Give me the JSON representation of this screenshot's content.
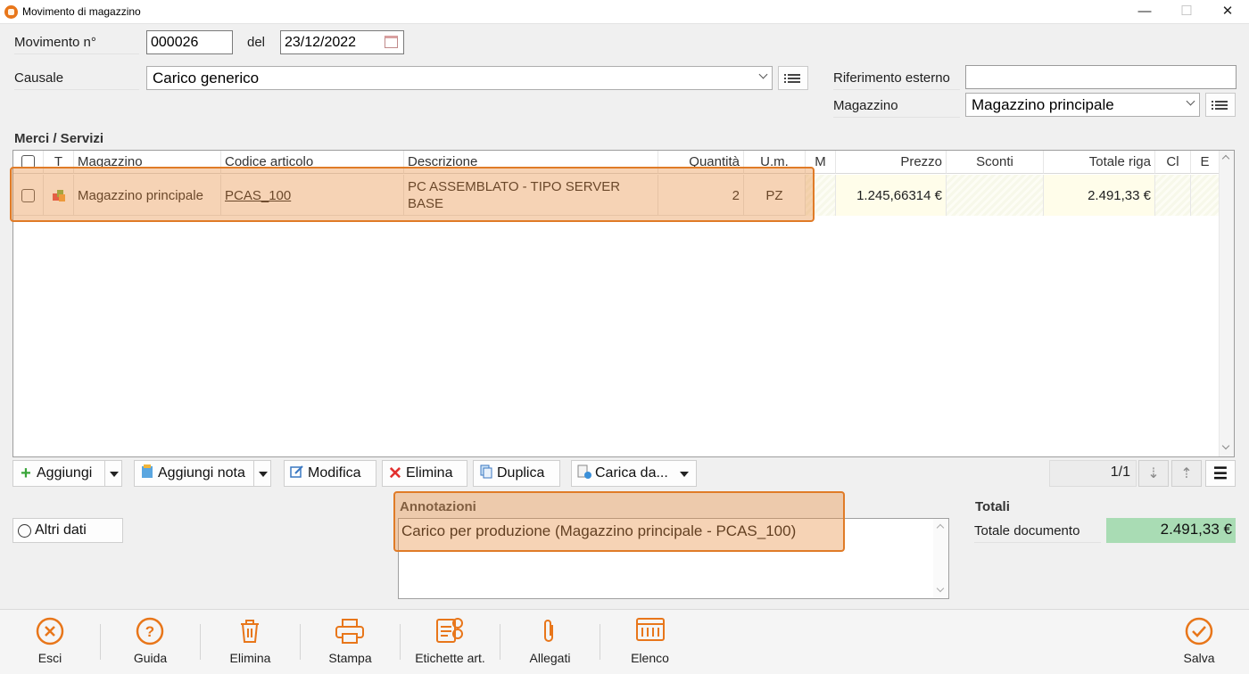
{
  "window": {
    "title": "Movimento di magazzino",
    "min": "—",
    "max": "☐",
    "close": "✕"
  },
  "header": {
    "movimento_label": "Movimento n°",
    "movimento_value": "000026",
    "del_label": "del",
    "date_value": "23/12/2022",
    "causale_label": "Causale",
    "causale_value": "Carico generico",
    "riferimento_label": "Riferimento esterno",
    "riferimento_value": "",
    "magazzino_label": "Magazzino",
    "magazzino_value": "Magazzino principale"
  },
  "section_title": "Merci / Servizi",
  "grid": {
    "columns": [
      "T",
      "Magazzino",
      "Codice articolo",
      "Descrizione",
      "Quantità",
      "U.m.",
      "M",
      "Prezzo",
      "Sconti",
      "Totale riga",
      "Cl",
      "E"
    ],
    "rows": [
      {
        "magazzino": "Magazzino principale",
        "codice": "PCAS_100",
        "descrizione": "PC ASSEMBLATO - TIPO SERVER BASE",
        "quantita": "2",
        "um": "PZ",
        "m": "",
        "prezzo": "1.245,66314 €",
        "sconti": "",
        "totale": "2.491,33 €",
        "cl": "",
        "e": ""
      }
    ]
  },
  "toolbar": {
    "aggiungi": "Aggiungi",
    "aggiungi_nota": "Aggiungi nota",
    "modifica": "Modifica",
    "elimina": "Elimina",
    "duplica": "Duplica",
    "carica_da": "Carica da...",
    "pager": "1/1"
  },
  "altri_dati": "Altri dati",
  "annotazioni": {
    "label": "Annotazioni",
    "text": "Carico per produzione (Magazzino principale - PCAS_100)"
  },
  "totali": {
    "label": "Totali",
    "totale_documento_label": "Totale documento",
    "totale_documento_value": "2.491,33 €"
  },
  "bottom": {
    "esci": "Esci",
    "guida": "Guida",
    "elimina": "Elimina",
    "stampa": "Stampa",
    "etichette": "Etichette art.",
    "allegati": "Allegati",
    "elenco": "Elenco",
    "salva": "Salva"
  },
  "colors": {
    "accent": "#e8761a",
    "total_bg": "#a9dcb4",
    "highlight": "#e07b27"
  }
}
